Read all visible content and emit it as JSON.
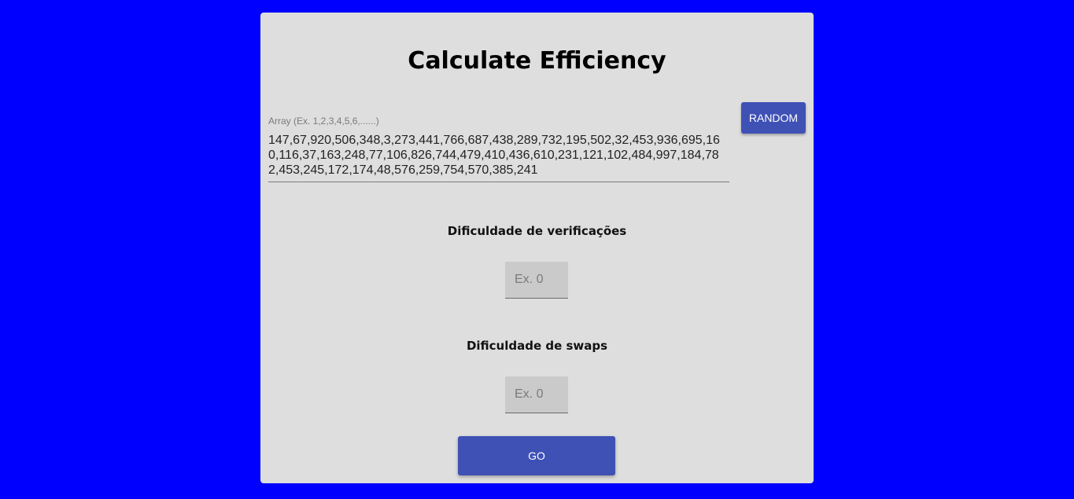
{
  "page": {
    "background_color": "#0000ff",
    "title": "Calculate Efficiency"
  },
  "array_field": {
    "label": "Array (Ex. 1,2,3,4,5,6,......)",
    "value": "147,67,920,506,348,3,273,441,766,687,438,289,732,195,502,32,453,936,695,160,116,37,163,248,77,106,826,744,479,410,436,610,231,121,102,484,997,184,782,453,245,172,174,48,576,259,754,570,385,241"
  },
  "random_button": {
    "label": "RANDOM",
    "color": "#3f51b5"
  },
  "verifications": {
    "label": "Dificuldade de verificações",
    "placeholder": "Ex. 0"
  },
  "swaps": {
    "label": "Dificuldade de swaps",
    "placeholder": "Ex. 0"
  },
  "go_button": {
    "label": "GO",
    "color": "#3f51b5"
  }
}
